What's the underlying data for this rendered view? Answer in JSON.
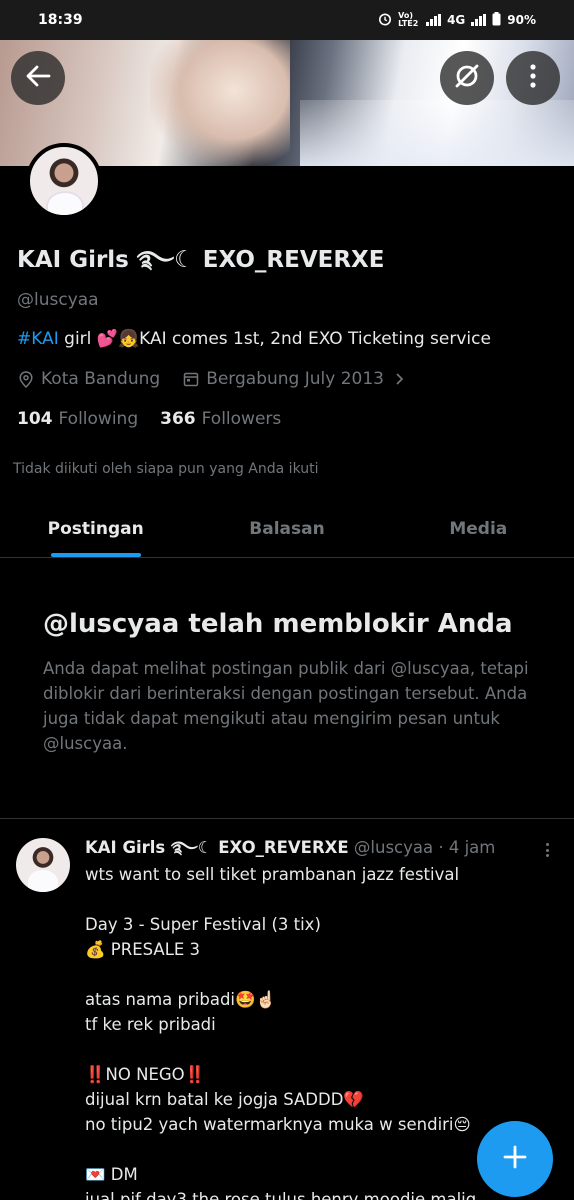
{
  "status_bar": {
    "time": "18:39",
    "volte_label": "Vo) LTE2",
    "network_label": "4G",
    "battery": "90%"
  },
  "header": {
    "back_icon": "arrow-left-icon",
    "grok_icon": "grok-icon",
    "more_icon": "more-vertical-icon"
  },
  "profile": {
    "display_name": "KAI Girls ࿐☾ EXO_REVERXE",
    "handle": "@luscyaa",
    "bio": {
      "hashtag": "#KAI",
      "text": " girl 💕👧KAI comes 1st, 2nd EXO  Ticketing service"
    },
    "location": "Kota Bandung",
    "joined": "Bergabung July 2013",
    "following_count": "104",
    "following_label": "Following",
    "followers_count": "366",
    "followers_label": "Followers",
    "not_followed_note": "Tidak diikuti oleh siapa pun yang Anda ikuti"
  },
  "tabs": [
    {
      "label": "Postingan",
      "active": true
    },
    {
      "label": "Balasan",
      "active": false
    },
    {
      "label": "Media",
      "active": false
    }
  ],
  "blocked": {
    "title": "@luscyaa telah memblokir Anda",
    "text": "Anda dapat melihat postingan publik dari @luscyaa, tetapi diblokir dari berinteraksi dengan postingan tersebut. Anda juga tidak dapat mengikuti atau mengirim pesan untuk @luscyaa."
  },
  "post": {
    "name": "KAI Girls ࿐☾ EXO_REVERXE",
    "handle": "@luscyaa",
    "separator": "·",
    "time": "4 jam",
    "lines": [
      "wts want to sell tiket prambanan jazz festival",
      "",
      "Day 3 - Super Festival (3 tix)",
      "💰 PRESALE 3",
      "",
      "atas nama pribadi🤩☝🏻",
      "tf ke rek pribadi",
      "",
      "‼️NO NEGO‼️",
      "dijual krn batal ke jogja SADDD💔",
      "no tipu2 yach watermarknya muka w sendiri😔",
      "",
      "💌 DM",
      "jual pjf day3 the rose tulus henry moodie malig"
    ]
  },
  "fab_icon": "plus-icon",
  "colors": {
    "accent": "#1d9bf0",
    "background": "#000000",
    "text_primary": "#e7e9ea",
    "text_secondary": "#71767b"
  }
}
